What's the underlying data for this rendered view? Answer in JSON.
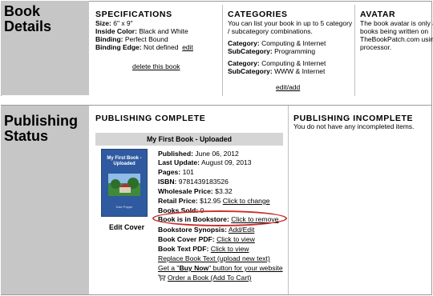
{
  "book_details": {
    "heading": "Book Details",
    "specifications": {
      "title": "SPECIFICATIONS",
      "size_label": "Size:",
      "size_value": "6\" x 9\"",
      "inside_label": "Inside Color:",
      "inside_value": "Black and White",
      "binding_label": "Binding:",
      "binding_value": "Perfect Bound",
      "edge_label": "Binding Edge:",
      "edge_value": "Not defined",
      "edit_link": "edit",
      "delete_link": "delete this book"
    },
    "categories": {
      "title": "CATEGORIES",
      "intro_line1": "You can list your book in up to 5 category",
      "intro_line2": "/ subcategory combinations.",
      "groups": [
        {
          "cat_label": "Category:",
          "cat_value": "Computing & Internet",
          "sub_label": "SubCategory:",
          "sub_value": "Programming"
        },
        {
          "cat_label": "Category:",
          "cat_value": "Computing & Internet",
          "sub_label": "SubCategory:",
          "sub_value": "WWW & Internet"
        }
      ],
      "edit_add_link": "edit/add"
    },
    "avatar": {
      "title": "AVATAR",
      "line1": "The book avatar is only a",
      "line2": "books being written on",
      "line3": "TheBookPatch.com using",
      "line4": "processor."
    }
  },
  "publishing_status": {
    "heading_line1": "Publishing",
    "heading_line2": "Status",
    "complete": {
      "title": "PUBLISHING COMPLETE",
      "book_bar": "My First Book - Uploaded",
      "cover_title_line1": "My First Book -",
      "cover_title_line2": "Uploaded",
      "cover_author": "Kale Poppe",
      "edit_cover": "Edit Cover",
      "published_label": "Published:",
      "published_value": "June 06, 2012",
      "last_update_label": "Last Update:",
      "last_update_value": "August 09, 2013",
      "pages_label": "Pages:",
      "pages_value": "101",
      "isbn_label": "ISBN:",
      "isbn_value": "9781439183526",
      "wholesale_label": "Wholesale Price:",
      "wholesale_value": "$3.32",
      "retail_label": "Retail Price:",
      "retail_value": "$12.95",
      "retail_link": "Click to change",
      "books_sold_label": "Books Sold:",
      "books_sold_value": "0",
      "bookstore_label": "Book is in Bookstore:",
      "bookstore_link": "Click to remove",
      "synopsis_label": "Bookstore Synopsis:",
      "synopsis_link": "Add/Edit",
      "cover_pdf_label": "Book Cover PDF:",
      "cover_pdf_link": "Click to view",
      "text_pdf_label": "Book Text PDF:",
      "text_pdf_link": "Click to view",
      "replace_link": "Replace Book Text (upload new text)",
      "buy_now_pre": "Get a \"",
      "buy_now_bold": "Buy Now",
      "buy_now_post": "\" button for your website",
      "order_link": "Order a Book (Add To Cart)"
    },
    "incomplete": {
      "title": "PUBLISHING INCOMPLETE",
      "message": "You do not have any incompleted items."
    }
  },
  "colors": {
    "section_header_bg": "#c6c6c6",
    "highlight_oval": "#c9302c",
    "cover_blue": "#2f5aa0"
  }
}
